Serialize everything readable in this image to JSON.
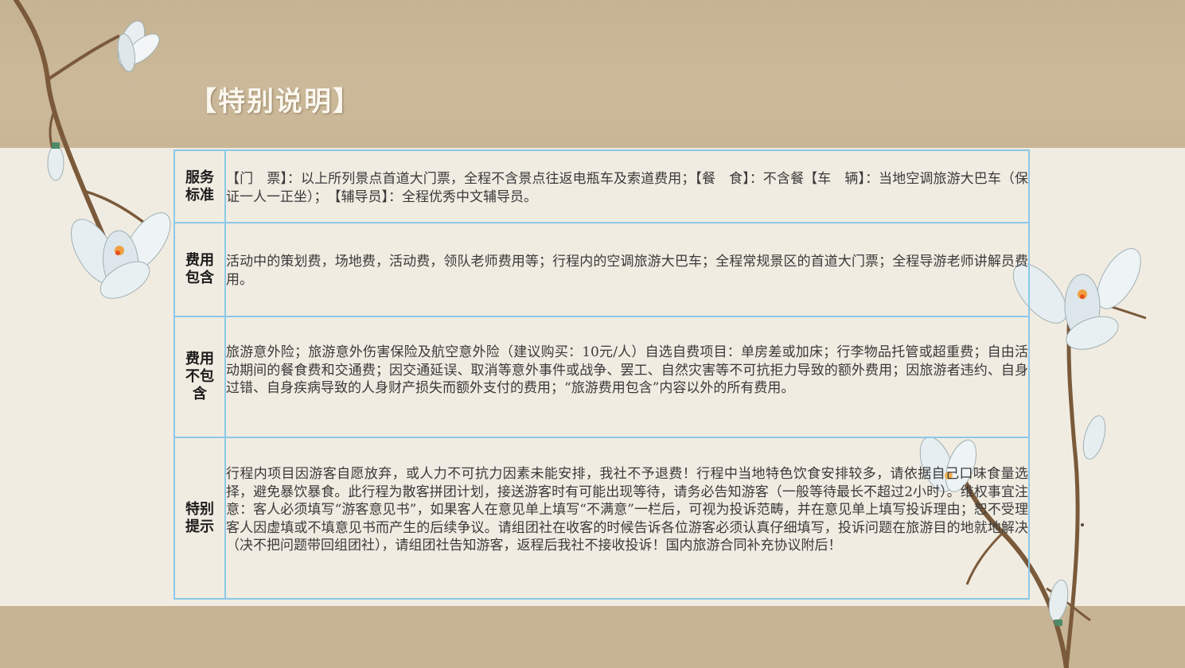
{
  "title": "【特别说明】",
  "rows": [
    {
      "label": "服务\n标准",
      "content": "【门　票】：以上所列景点首道大门票，全程不含景点往返电瓶车及索道费用；【餐　食】：不含餐【车　辆】：当地空调旅游大巴车（保证一人一正坐）；　【辅导员】：全程优秀中文辅导员。"
    },
    {
      "label": "费用\n包含",
      "content": "活动中的策划费，场地费，活动费，领队老师费用等；行程内的空调旅游大巴车；全程常规景区的首道大门票；全程导游老师讲解员费用。"
    },
    {
      "label": "费用\n不包\n含",
      "content": "旅游意外险；旅游意外伤害保险及航空意外险（建议购买：10元/人）自选自费项目：单房差或加床；行李物品托管或超重费；自由活动期间的餐食费和交通费；因交通延误、取消等意外事件或战争、罢工、自然灾害等不可抗拒力导致的额外费用；因旅游者违约、自身过错、自身疾病导致的人身财产损失而额外支付的费用；“旅游费用包含”内容以外的所有费用。"
    },
    {
      "label": "特别\n提示",
      "content": "行程内项目因游客自愿放弃，或人力不可抗力因素未能安排，我社不予退费！行程中当地特色饮食安排较多，请依据自己口味食量选择，避免暴饮暴食。此行程为散客拼团计划，接送游客时有可能出现等待，请务必告知游客（一般等待最长不超过2小时）。维权事宜注意：客人必须填写“游客意见书”，如果客人在意见单上填写“不满意”一栏后，可视为投诉范畴，并在意见单上填写投诉理由；恕不受理客人因虚填或不填意见书而产生的后续争议。请组团社在收客的时候告诉各位游客必须认真仔细填写，投诉问题在旅游目的地就地解决（决不把问题带回组团社），请组团社告知游客，返程后我社不接收投诉！国内旅游合同补充协议附后！"
    }
  ],
  "colors": {
    "paper": "#c8b697",
    "light_band": "#f1ece2",
    "table_border": "#8cc8e8"
  },
  "decorations": [
    "magnolia-branch-left",
    "magnolia-branch-right"
  ]
}
